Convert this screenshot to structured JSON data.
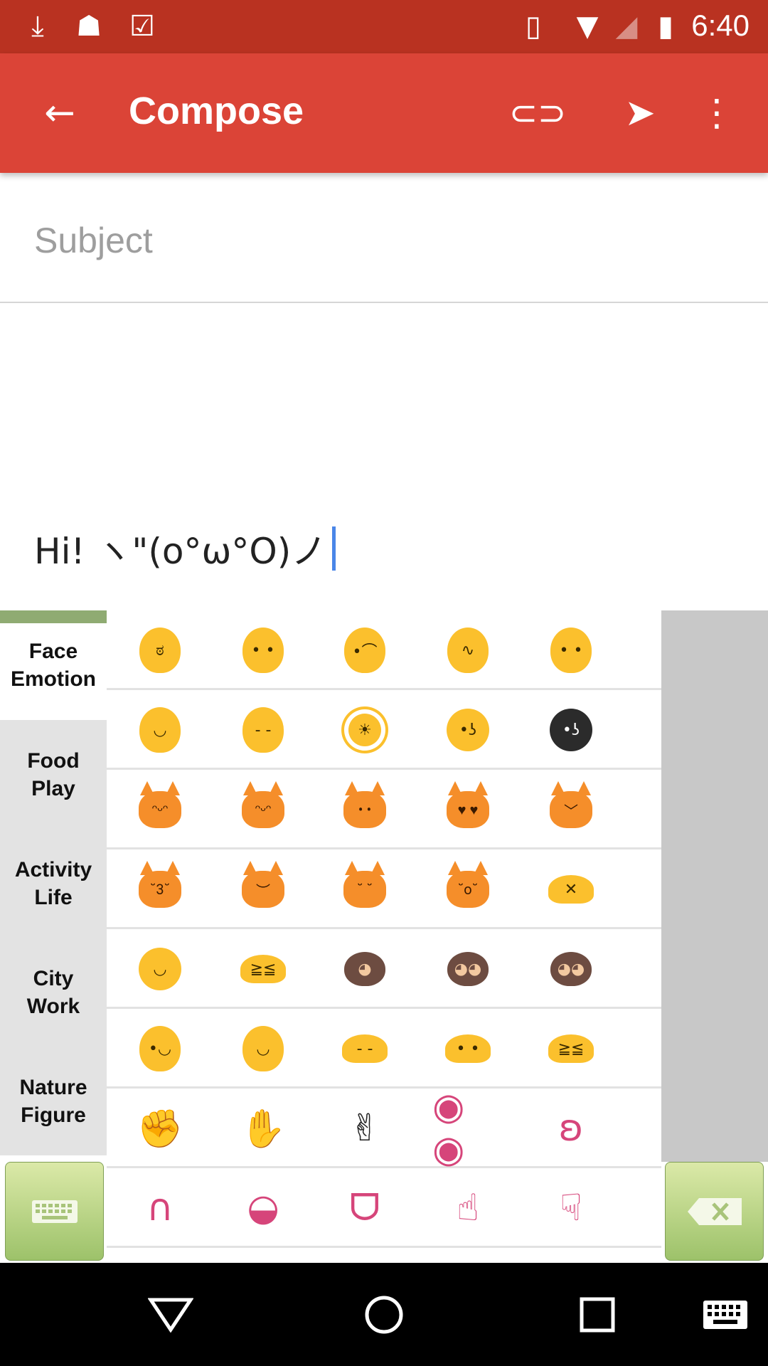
{
  "status_bar": {
    "left_icons": [
      "download-icon",
      "android-debug-icon",
      "clipboard-check-icon"
    ],
    "right_icons": [
      "vibrate-icon",
      "wifi-icon",
      "cell-signal-icon",
      "battery-charging-icon"
    ],
    "time": "6:40",
    "color": "#b93221"
  },
  "app_bar": {
    "title": "Compose",
    "color": "#db4437",
    "actions": [
      "back-arrow-icon",
      "attach-icon",
      "send-icon",
      "more-vert-icon"
    ]
  },
  "compose": {
    "subject_placeholder": "Subject",
    "body_text": "Hi! ヽ\"(o°ω°O)ノ"
  },
  "keyboard": {
    "categories": [
      {
        "line1": "Face",
        "line2": "Emotion",
        "selected": true
      },
      {
        "line1": "Food",
        "line2": "Play",
        "selected": false
      },
      {
        "line1": "Activity",
        "line2": "Life",
        "selected": false
      },
      {
        "line1": "City",
        "line2": "Work",
        "selected": false
      },
      {
        "line1": "Nature",
        "line2": "Figure",
        "selected": false
      }
    ],
    "indicator_color": "#8fab72",
    "keyboard_button_icon": "keyboard-icon",
    "backspace_button_icon": "backspace-icon",
    "emoji_rows": [
      [
        {
          "name": "angry-grimace-face",
          "kind": "face",
          "color": "#fbc02d",
          "g": "ಠ"
        },
        {
          "name": "neutral-face",
          "kind": "face",
          "color": "#fbc02d",
          "g": "• •"
        },
        {
          "name": "confused-face",
          "kind": "face",
          "color": "#fbc02d",
          "g": "•⌒"
        },
        {
          "name": "zipper-mouth-face",
          "kind": "face",
          "color": "#fbc02d",
          "g": "∿"
        },
        {
          "name": "no-mouth-face",
          "kind": "face",
          "color": "#fbc02d",
          "g": "• •"
        }
      ],
      [
        {
          "name": "smiling-face-with-halo",
          "kind": "face",
          "color": "#fbc02d",
          "g": "◡"
        },
        {
          "name": "expressionless-face",
          "kind": "face",
          "color": "#fbc02d",
          "g": "- -"
        },
        {
          "name": "sun-with-face",
          "kind": "sun",
          "color": "#fbc02d",
          "g": "☀"
        },
        {
          "name": "full-moon-face",
          "kind": "round",
          "color": "#fbc02d",
          "g": "•ʖ"
        },
        {
          "name": "new-moon-face",
          "kind": "round",
          "color": "#2b2b2b",
          "g": "•ʖ"
        }
      ],
      [
        {
          "name": "grinning-cat",
          "kind": "cat",
          "color": "#f58e2a",
          "g": "ᵔᵕᵔ"
        },
        {
          "name": "cat-tears-of-joy",
          "kind": "cat",
          "color": "#f58e2a",
          "g": "ᵔᵕᵔ"
        },
        {
          "name": "smiling-cat",
          "kind": "cat",
          "color": "#f58e2a",
          "g": "• •"
        },
        {
          "name": "heart-eyes-cat",
          "kind": "cat",
          "color": "#f58e2a",
          "g": "♥ ♥"
        },
        {
          "name": "smirk-cat",
          "kind": "cat",
          "color": "#f58e2a",
          "g": "﹀"
        }
      ],
      [
        {
          "name": "kissing-cat",
          "kind": "cat",
          "color": "#f58e2a",
          "g": "˘3˘"
        },
        {
          "name": "pouting-cat",
          "kind": "cat",
          "color": "#f58e2a",
          "g": "︶"
        },
        {
          "name": "crying-cat",
          "kind": "cat",
          "color": "#f58e2a",
          "g": "˘ ˘"
        },
        {
          "name": "weary-cat",
          "kind": "cat",
          "color": "#f58e2a",
          "g": "˘o˘"
        },
        {
          "name": "no-good-gesture",
          "kind": "blob",
          "color": "#fbc02d",
          "g": "✕"
        }
      ],
      [
        {
          "name": "ok-gesture",
          "kind": "round",
          "color": "#fbc02d",
          "g": "◡"
        },
        {
          "name": "person-bowing",
          "kind": "blob",
          "color": "#fbc02d",
          "g": "≧≦"
        },
        {
          "name": "see-no-evil-monkey",
          "kind": "monkey",
          "color": "#6d4c41",
          "g": "◕"
        },
        {
          "name": "hear-no-evil-monkey",
          "kind": "monkey",
          "color": "#6d4c41",
          "g": "◕◕"
        },
        {
          "name": "speak-no-evil-monkey",
          "kind": "monkey",
          "color": "#6d4c41",
          "g": "◕◕"
        }
      ],
      [
        {
          "name": "raising-hand",
          "kind": "face",
          "color": "#fbc02d",
          "g": "•◡"
        },
        {
          "name": "raising-both-hands",
          "kind": "face",
          "color": "#fbc02d",
          "g": "◡"
        },
        {
          "name": "person-frowning",
          "kind": "blob",
          "color": "#fbc02d",
          "g": "- -"
        },
        {
          "name": "person-pouting",
          "kind": "blob",
          "color": "#fbc02d",
          "g": "• •"
        },
        {
          "name": "person-with-folded-hands",
          "kind": "blob",
          "color": "#fbc02d",
          "g": "≧≦"
        }
      ],
      [
        {
          "name": "fist",
          "kind": "line",
          "color": "#d6457a",
          "g": "✊"
        },
        {
          "name": "raised-hand",
          "kind": "line",
          "color": "#d6457a",
          "g": "✋"
        },
        {
          "name": "victory-hand",
          "kind": "line",
          "color": "#222222",
          "g": "✌"
        },
        {
          "name": "eyes",
          "kind": "line",
          "color": "#d6457a",
          "g": "◉ ◉"
        },
        {
          "name": "ear",
          "kind": "line",
          "color": "#d6457a",
          "g": "ʚ"
        }
      ],
      [
        {
          "name": "nose",
          "kind": "line",
          "color": "#d6457a",
          "g": "∩"
        },
        {
          "name": "mouth",
          "kind": "line",
          "color": "#d6457a",
          "g": "◒"
        },
        {
          "name": "tongue",
          "kind": "line",
          "color": "#d6457a",
          "g": "ᗜ"
        },
        {
          "name": "pointing-up-hand",
          "kind": "line",
          "color": "#d6457a",
          "g": "☝"
        },
        {
          "name": "pointing-down-hand",
          "kind": "line",
          "color": "#d6457a",
          "g": "☟"
        }
      ]
    ]
  },
  "nav_bar": [
    "back-triangle-icon",
    "home-circle-icon",
    "recents-square-icon",
    "keyboard-switch-icon"
  ]
}
